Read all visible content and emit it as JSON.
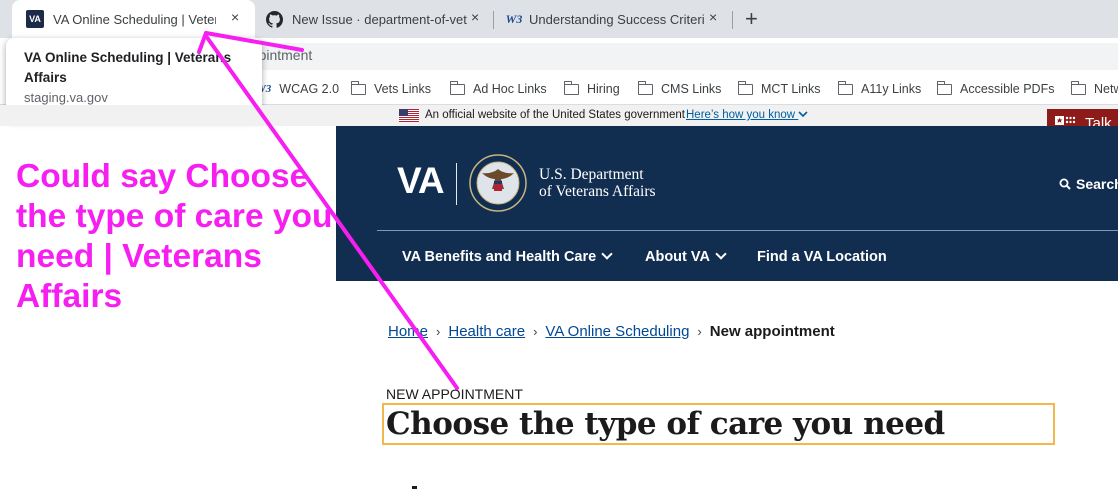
{
  "browser": {
    "tabs": [
      {
        "title": "VA Online Scheduling | Veteran",
        "favicon": "va-favicon",
        "active": true
      },
      {
        "title": "New Issue · department-of-vet",
        "favicon": "github-icon",
        "active": false
      },
      {
        "title": "Understanding Success Criteri",
        "favicon": "w3c-favicon",
        "active": false
      }
    ],
    "close_glyph": "×",
    "new_tab_glyph": "+",
    "address_fragment": "ppointment",
    "bookmarks": [
      {
        "label": "WCAG 2.0",
        "icon": "w3c-favicon"
      },
      {
        "label": "Vets Links",
        "icon": "folder-icon"
      },
      {
        "label": "Ad Hoc Links",
        "icon": "folder-icon"
      },
      {
        "label": "Hiring",
        "icon": "folder-icon"
      },
      {
        "label": "CMS Links",
        "icon": "folder-icon"
      },
      {
        "label": "MCT Links",
        "icon": "folder-icon"
      },
      {
        "label": "A11y Links",
        "icon": "folder-icon"
      },
      {
        "label": "Accessible PDFs",
        "icon": "folder-icon"
      },
      {
        "label": "Netw",
        "icon": "folder-icon"
      }
    ],
    "tooltip": {
      "title": "VA Online Scheduling | Veterans Affairs",
      "url": "staging.va.gov"
    }
  },
  "site": {
    "gov_banner": {
      "text": "An official website of the United States government",
      "link": "Here’s how you know"
    },
    "talk_label": "Talk",
    "logo_text": "VA",
    "department_line1": "U.S. Department",
    "department_line2": "of Veterans Affairs",
    "search_label": "Search",
    "nav": [
      {
        "label": "VA Benefits and Health Care",
        "has_menu": true
      },
      {
        "label": "About VA",
        "has_menu": true
      },
      {
        "label": "Find a VA Location",
        "has_menu": false
      }
    ],
    "breadcrumbs": [
      {
        "label": "Home",
        "link": true
      },
      {
        "label": "Health care",
        "link": true
      },
      {
        "label": "VA Online Scheduling",
        "link": true
      },
      {
        "label": "New appointment",
        "link": false
      }
    ],
    "breadcrumb_separator": "›",
    "eyebrow": "NEW APPOINTMENT",
    "heading": "Choose the type of care you need"
  },
  "annotation": {
    "text": "Could say Choose the type of care you need | Veterans Affairs",
    "color": "#f61ef1"
  },
  "colors": {
    "va_navy": "#112e51",
    "focus_outline": "#f2b84b",
    "link_blue": "#004795",
    "annotation": "#f61ef1"
  }
}
